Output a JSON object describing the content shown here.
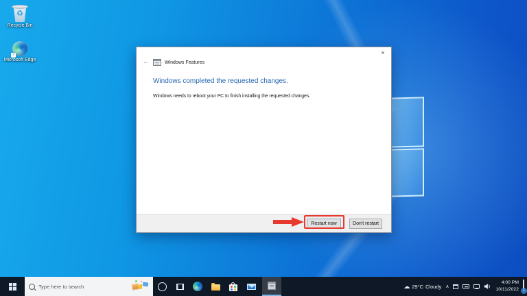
{
  "desktop": {
    "icons": [
      {
        "label": "Recycle Bin"
      },
      {
        "label": "Microsoft Edge"
      }
    ]
  },
  "dialog": {
    "window_title": "Windows Features",
    "heading": "Windows completed the requested changes.",
    "body": "Windows needs to reboot your PC to finish installing the requested changes.",
    "buttons": {
      "restart_now": "Restart now",
      "dont_restart": "Don't restart"
    }
  },
  "glyphs": {
    "back": "←",
    "close": "×",
    "chevron": "∧",
    "cloud": "☁",
    "recycle": "♻",
    "shortcut_arrow": "↗"
  },
  "taskbar": {
    "search": {
      "placeholder": "Type here to search"
    },
    "apps": [
      "cortana",
      "task-view",
      "microsoft-edge",
      "file-explorer",
      "microsoft-store",
      "mail",
      "windows-features"
    ],
    "active_app": "windows-features",
    "tray": {
      "weather": {
        "temperature": "29°C",
        "condition": "Cloudy"
      },
      "icons": [
        "window-icon",
        "keyboard-icon",
        "network-icon",
        "volume-icon"
      ],
      "clock": {
        "time": "4:00 PM",
        "date": "10/11/2022"
      },
      "notification_badge": "1"
    }
  },
  "colors": {
    "taskbar_bg": "#0e1826",
    "wallpaper_light": "#18a9ec",
    "wallpaper_dark": "#0c4ec1",
    "heading_blue": "#2766b0",
    "annotation_red": "#e8392f",
    "accent": "#0078d7"
  }
}
